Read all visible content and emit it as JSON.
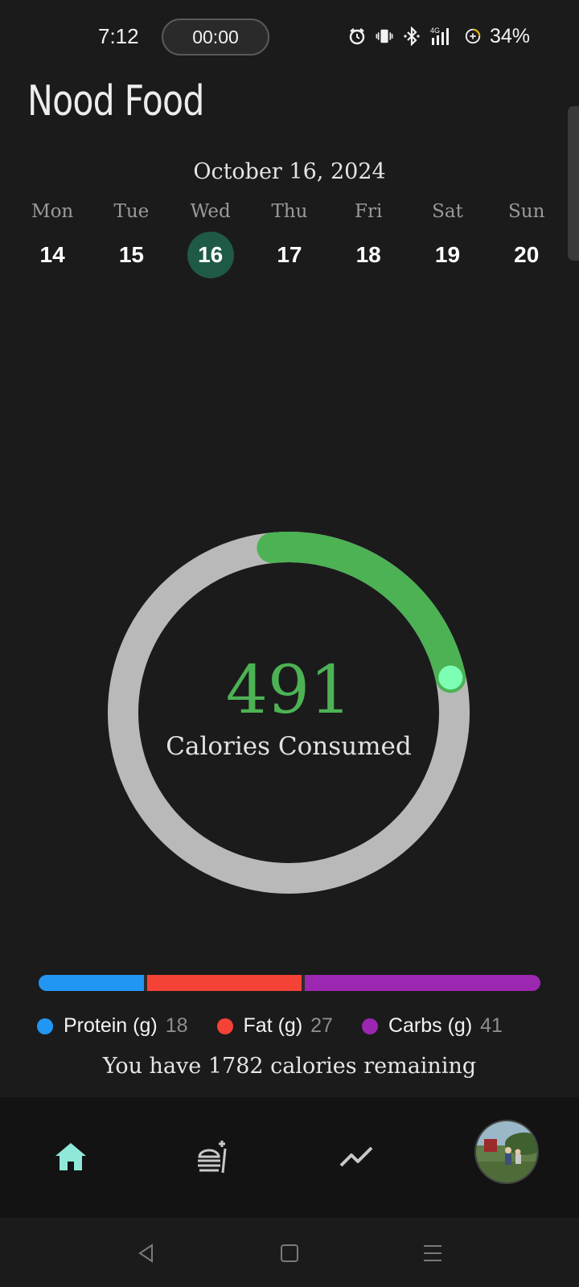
{
  "status_bar": {
    "time": "7:12",
    "timer": "00:00",
    "icons": [
      "alarm-icon",
      "vibrate-icon",
      "bluetooth-icon",
      "signal-icon",
      "battery-saver-icon"
    ],
    "network_label": "4G",
    "battery": "34%"
  },
  "app": {
    "title": "Nood Food"
  },
  "calendar": {
    "date_heading": "October 16, 2024",
    "days": [
      {
        "name": "Mon",
        "num": "14"
      },
      {
        "name": "Tue",
        "num": "15"
      },
      {
        "name": "Wed",
        "num": "16"
      },
      {
        "name": "Thu",
        "num": "17"
      },
      {
        "name": "Fri",
        "num": "18"
      },
      {
        "name": "Sat",
        "num": "19"
      },
      {
        "name": "Sun",
        "num": "20"
      }
    ],
    "selected_index": 2
  },
  "calories": {
    "consumed": "491",
    "label": "Calories Consumed",
    "progress_fraction": 0.216,
    "progress_color": "#4cb254",
    "track_color": "#b9b9b9"
  },
  "macros": {
    "items": [
      {
        "label": "Protein (g)",
        "value": "18",
        "color": "#2196f3"
      },
      {
        "label": "Fat (g)",
        "value": "27",
        "color": "#f44336"
      },
      {
        "label": "Carbs (g)",
        "value": "41",
        "color": "#9c27b0"
      }
    ],
    "remaining_text": "You have 1782 calories remaining"
  },
  "bottom_nav": {
    "items": [
      "home-icon",
      "food-log-icon",
      "trends-icon",
      "profile-avatar"
    ],
    "active_color": "#8fe8d8"
  },
  "system_nav": [
    "back-icon",
    "home-square-icon",
    "menu-icon"
  ]
}
